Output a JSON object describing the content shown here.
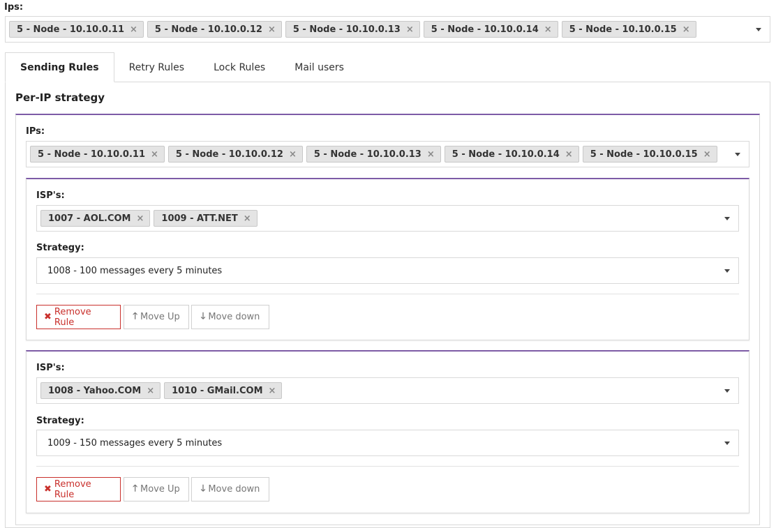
{
  "top": {
    "label": "Ips:",
    "ips": [
      "5 - Node - 10.10.0.11",
      "5 - Node - 10.10.0.12",
      "5 - Node - 10.10.0.13",
      "5 - Node - 10.10.0.14",
      "5 - Node - 10.10.0.15"
    ]
  },
  "tabs": [
    "Sending Rules",
    "Retry Rules",
    "Lock Rules",
    "Mail users"
  ],
  "section_title": "Per-IP strategy",
  "ip_panel": {
    "label": "IPs:",
    "ips": [
      "5 - Node - 10.10.0.11",
      "5 - Node - 10.10.0.12",
      "5 - Node - 10.10.0.13",
      "5 - Node - 10.10.0.14",
      "5 - Node - 10.10.0.15"
    ]
  },
  "rules": [
    {
      "isp_label": "ISP's:",
      "isps": [
        "1007 - AOL.COM",
        "1009 - ATT.NET"
      ],
      "strategy_label": "Strategy:",
      "strategy": "1008 - 100 messages every 5 minutes"
    },
    {
      "isp_label": "ISP's:",
      "isps": [
        "1008 - Yahoo.COM",
        "1010 - GMail.COM"
      ],
      "strategy_label": "Strategy:",
      "strategy": "1009 - 150 messages every 5 minutes"
    }
  ],
  "buttons": {
    "remove": "Remove Rule",
    "up": "Move Up",
    "down": "Move down"
  },
  "icons": {
    "remove_tag": "×",
    "remove": "✖",
    "up": "🡑",
    "down": "🡓"
  },
  "colors": {
    "accent": "#7d5ba6",
    "danger": "#c9302c"
  }
}
